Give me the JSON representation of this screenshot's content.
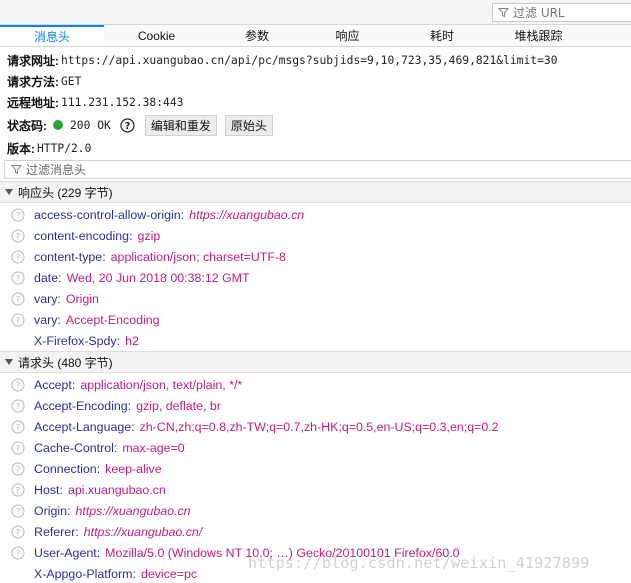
{
  "url_filter": {
    "placeholder": "过滤 URL"
  },
  "tabs": [
    {
      "label": "消息头",
      "active": true
    },
    {
      "label": "Cookie",
      "active": false
    },
    {
      "label": "参数",
      "active": false
    },
    {
      "label": "响应",
      "active": false
    },
    {
      "label": "耗时",
      "active": false
    },
    {
      "label": "堆栈跟踪",
      "active": false
    }
  ],
  "summary": {
    "request_url": {
      "label": "请求网址:",
      "value": "https://api.xuangubao.cn/api/pc/msgs?subjids=9,10,723,35,469,821&limit=30"
    },
    "method": {
      "label": "请求方法:",
      "value": "GET"
    },
    "remote": {
      "label": "远程地址:",
      "value": "111.231.152.38:443"
    },
    "status": {
      "label": "状态码:",
      "value": "200 OK",
      "color": "#2fa33a",
      "edit_resend": "编辑和重发",
      "raw_headers": "原始头"
    },
    "version": {
      "label": "版本:",
      "value": "HTTP/2.0"
    }
  },
  "headers_filter": {
    "placeholder": "过滤消息头"
  },
  "response_headers": {
    "title": "响应头 (229 字节)",
    "items": [
      {
        "name": "access-control-allow-origin",
        "value": "https://xuangubao.cn",
        "link": true,
        "help": true
      },
      {
        "name": "content-encoding",
        "value": "gzip",
        "link": false,
        "help": true
      },
      {
        "name": "content-type",
        "value": "application/json; charset=UTF-8",
        "link": false,
        "help": true
      },
      {
        "name": "date",
        "value": "Wed, 20 Jun 2018 00:38:12 GMT",
        "link": false,
        "help": true
      },
      {
        "name": "vary",
        "value": "Origin",
        "link": false,
        "help": true
      },
      {
        "name": "vary",
        "value": "Accept-Encoding",
        "link": false,
        "help": true
      },
      {
        "name": "X-Firefox-Spdy",
        "value": "h2",
        "link": false,
        "help": false
      }
    ]
  },
  "request_headers": {
    "title": "请求头 (480 字节)",
    "items": [
      {
        "name": "Accept",
        "value": "application/json, text/plain, */*",
        "link": false,
        "help": true
      },
      {
        "name": "Accept-Encoding",
        "value": "gzip, deflate, br",
        "link": false,
        "help": true
      },
      {
        "name": "Accept-Language",
        "value": "zh-CN,zh;q=0.8,zh-TW;q=0.7,zh-HK;q=0.5,en-US;q=0.3,en;q=0.2",
        "link": false,
        "help": true
      },
      {
        "name": "Cache-Control",
        "value": "max-age=0",
        "link": false,
        "help": true
      },
      {
        "name": "Connection",
        "value": "keep-alive",
        "link": false,
        "help": true
      },
      {
        "name": "Host",
        "value": "api.xuangubao.cn",
        "link": false,
        "help": true
      },
      {
        "name": "Origin",
        "value": "https://xuangubao.cn",
        "link": true,
        "help": true
      },
      {
        "name": "Referer",
        "value": "https://xuangubao.cn/",
        "link": true,
        "help": true
      },
      {
        "name": "User-Agent",
        "value": "Mozilla/5.0 (Windows NT 10.0; …) Gecko/20100101 Firefox/60.0",
        "link": false,
        "help": true
      },
      {
        "name": "X-Appgo-Platform",
        "value": "device=pc",
        "link": false,
        "help": false
      }
    ]
  },
  "watermark": "https://blog.csdn.net/weixin_41927899"
}
